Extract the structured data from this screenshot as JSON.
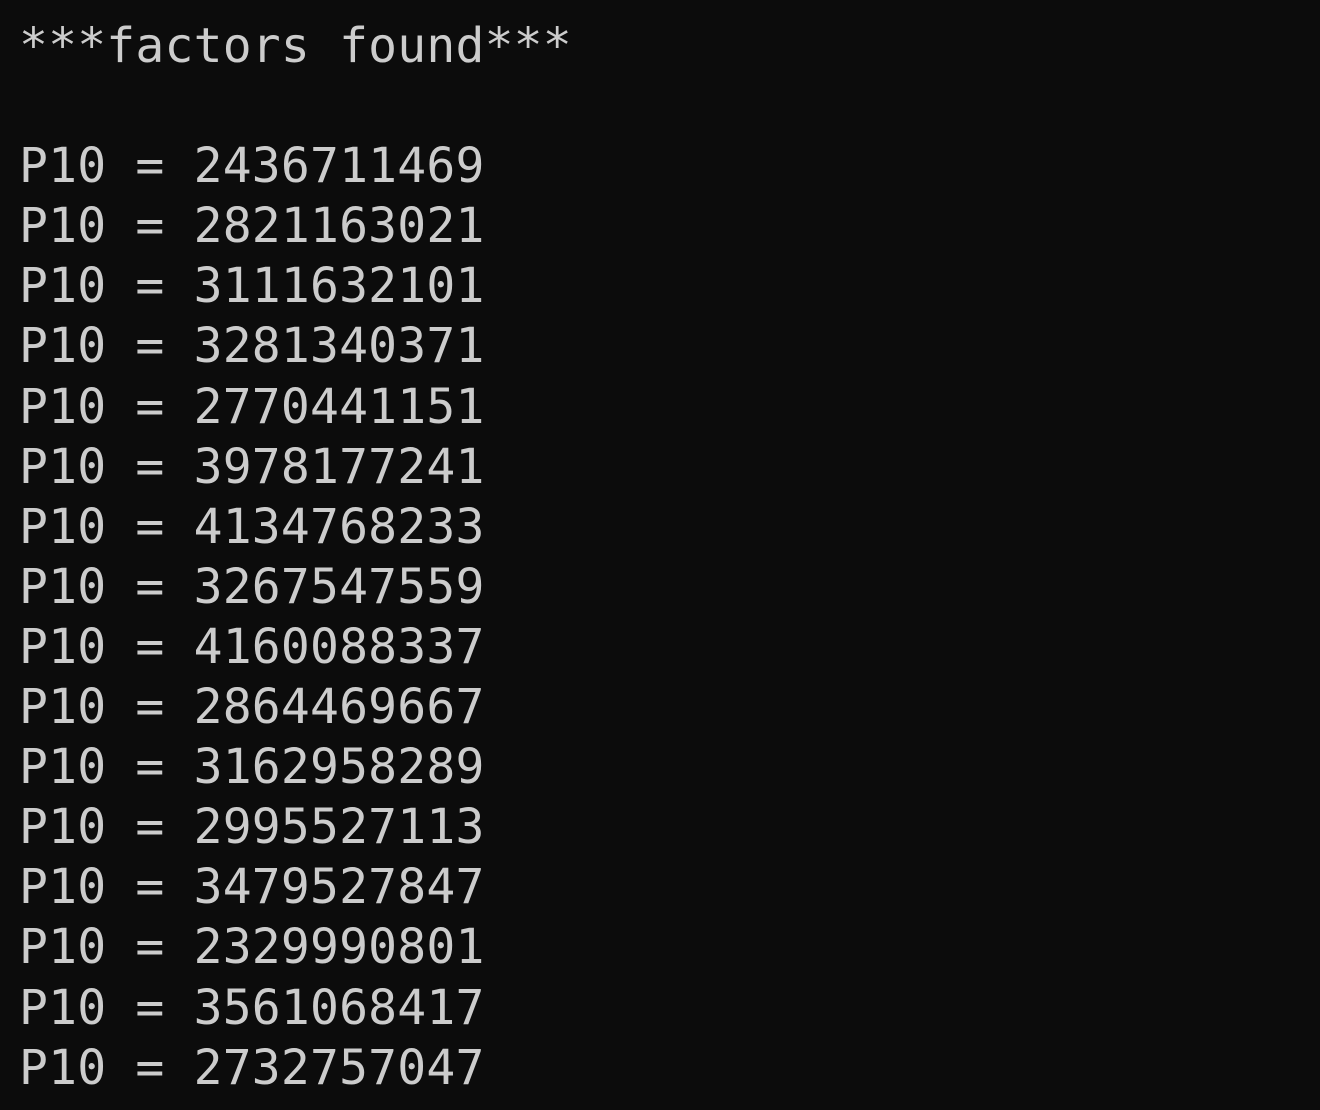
{
  "terminal": {
    "header": "***factors found***",
    "lines": [
      "P10 = 2436711469",
      "P10 = 2821163021",
      "P10 = 3111632101",
      "P10 = 3281340371",
      "P10 = 2770441151",
      "P10 = 3978177241",
      "P10 = 4134768233",
      "P10 = 3267547559",
      "P10 = 4160088337",
      "P10 = 2864469667",
      "P10 = 3162958289",
      "P10 = 2995527113",
      "P10 = 3479527847",
      "P10 = 2329990801",
      "P10 = 3561068417",
      "P10 = 2732757047"
    ],
    "colors": {
      "background": "#0c0c0c",
      "text": "#cccccc"
    }
  }
}
